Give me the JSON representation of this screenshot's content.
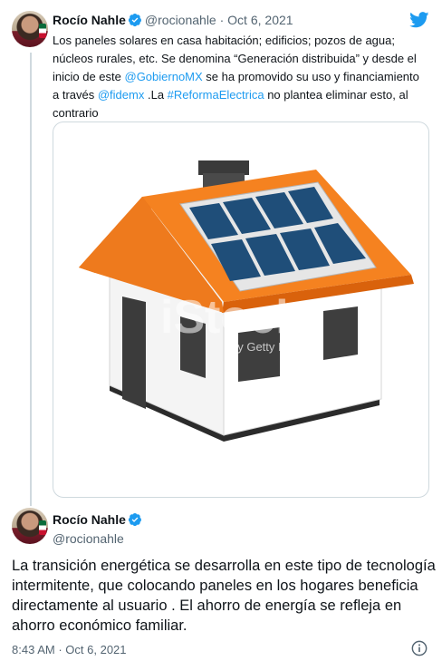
{
  "quoted_tweet": {
    "author_name": "Rocío Nahle",
    "handle": "@rocionahle",
    "separator": "·",
    "date": "Oct 6, 2021",
    "text_1": "Los paneles solares en casa habitación; edificios; pozos de agua; núcleos rurales, etc. Se denomina “Generación distribuida” y desde el inicio de este ",
    "mention_1": "@GobiernoMX",
    "text_2": " se ha promovido su uso y financiamiento a través ",
    "mention_2": "@fidemx",
    "text_3": " .La ",
    "hashtag": "#ReformaElectrica",
    "text_4": " no plantea eliminar esto, al contrario",
    "image": {
      "watermark": "iStock",
      "watermark_sub": "by Getty Images"
    }
  },
  "reply": {
    "author_name": "Rocío Nahle",
    "handle": "@rocionahle",
    "text": "La transición energética se desarrolla en este tipo de tecnología intermitente, que colocando paneles en los hogares beneficia directamente al usuario . El ahorro de energía se refleja en ahorro económico familiar.",
    "time": "8:43 AM",
    "separator": "·",
    "date": "Oct 6, 2021"
  },
  "icons": {
    "verified": "verified-badge-icon",
    "twitter": "twitter-bird-icon",
    "info": "info-icon"
  },
  "colors": {
    "link": "#1d9bf0",
    "muted": "#536471",
    "roof": "#f07a1a",
    "panel": "#1f4e79"
  }
}
